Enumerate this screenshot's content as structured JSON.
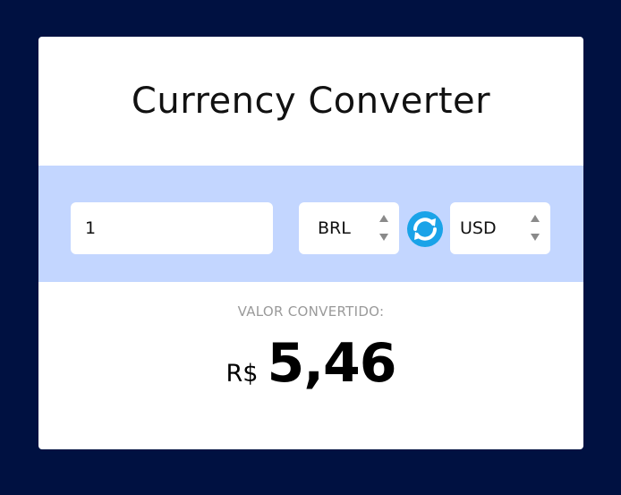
{
  "app": {
    "title": "Currency Converter"
  },
  "converter": {
    "amount_value": "1",
    "from_currency": "BRL",
    "to_currency": "USD",
    "swap_icon": "swap-arrows-icon"
  },
  "result": {
    "label": "VALOR CONVERTIDO:",
    "currency_symbol": "R$",
    "value": "5,46"
  },
  "colors": {
    "background": "#001141",
    "card": "#ffffff",
    "band": "#c3d6ff",
    "swap_button": "#1aa3e8"
  }
}
